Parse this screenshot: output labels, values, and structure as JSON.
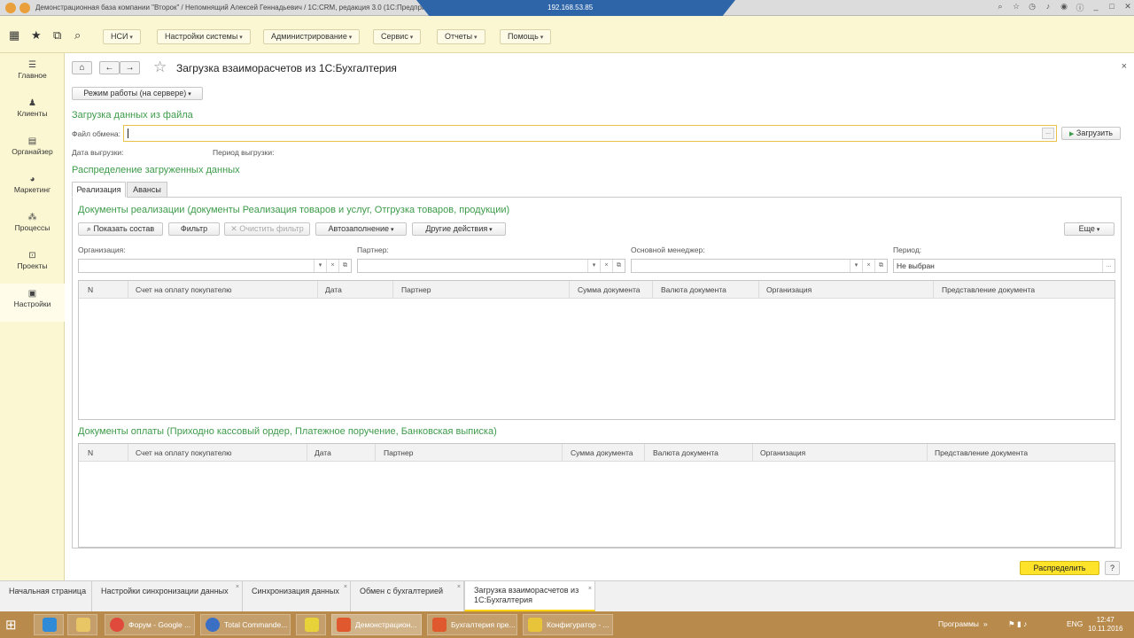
{
  "window": {
    "title": "Демонстрационная база компании \"Второк\" / Непомнящий Алексей Геннадьевич / 1С:CRM, редакция 3.0 (1С:Предприя...",
    "remote_ip": "192.168.53.85"
  },
  "menu": {
    "items": [
      "НСИ",
      "Настройки системы",
      "Администрирование",
      "Сервис",
      "Отчеты",
      "Помощь"
    ]
  },
  "sidebar": {
    "items": [
      {
        "label": "Главное",
        "icon": "menu-icon"
      },
      {
        "label": "Клиенты",
        "icon": "clients-icon"
      },
      {
        "label": "Органайзер",
        "icon": "calendar-icon"
      },
      {
        "label": "Маркетинг",
        "icon": "pie-chart-icon"
      },
      {
        "label": "Процессы",
        "icon": "process-icon"
      },
      {
        "label": "Проекты",
        "icon": "projects-icon"
      },
      {
        "label": "Настройки",
        "icon": "settings-icon"
      }
    ],
    "active_index": 6
  },
  "page": {
    "title": "Загрузка взаиморасчетов из 1С:Бухгалтерия",
    "mode_button": "Режим работы (на сервере)",
    "section_load": "Загрузка данных из файла",
    "file_label": "Файл обмена:",
    "file_value": "",
    "load_button": "Загрузить",
    "export_date_label": "Дата выгрузки:",
    "export_period_label": "Период выгрузки:",
    "section_distribution": "Распределение загруженных данных",
    "tabs": [
      "Реализация",
      "Авансы"
    ],
    "active_tab": 0,
    "sales_title": "Документы реализации (документы Реализация товаров и услуг, Отгрузка товаров, продукции)",
    "toolbar": {
      "show": "Показать состав",
      "filter": "Фильтр",
      "clear_filter": "Очистить фильтр",
      "autofill": "Автозаполнение",
      "other": "Другие действия",
      "more": "Еще"
    },
    "filters": {
      "org_label": "Организация:",
      "partner_label": "Партнер:",
      "manager_label": "Основной менеджер:",
      "period_label": "Период:",
      "period_value": "Не выбран"
    },
    "sales_columns": [
      "N",
      "Счет на оплату покупателю",
      "Дата",
      "Партнер",
      "Сумма документа",
      "Валюта документа",
      "Организация",
      "Представление документа"
    ],
    "payments_title": "Документы оплаты (Приходно кассовый ордер, Платежное поручение, Банковская выписка)",
    "payments_columns": [
      "N",
      "Счет на оплату покупателю",
      "Дата",
      "Партнер",
      "Сумма документа",
      "Валюта документа",
      "Организация",
      "Представление документа"
    ],
    "distribute_button": "Распределить",
    "help_button": "?"
  },
  "open_windows": [
    {
      "label": "Начальная страница",
      "closable": false
    },
    {
      "label": "Настройки синхронизации данных",
      "closable": true
    },
    {
      "label": "Синхронизация данных",
      "closable": true
    },
    {
      "label": "Обмен с бухгалтерией",
      "closable": true
    },
    {
      "label": "Загрузка взаиморасчетов из 1С:Бухгалтерия",
      "closable": true
    }
  ],
  "taskbar": {
    "items": [
      {
        "label": "Форум - Google ...",
        "color": "#e04a3c"
      },
      {
        "label": "Total Commande...",
        "color": "#3a6fc4"
      },
      {
        "label": "",
        "color": "#e8d23a"
      },
      {
        "label": "Демонстрацион...",
        "color": "#e0582e"
      },
      {
        "label": "Бухгалтерия пре...",
        "color": "#e0582e"
      },
      {
        "label": "Конфигуратор - ...",
        "color": "#e8c43a"
      }
    ],
    "tray_programs": "Программы",
    "lang": "ENG",
    "time": "12:47",
    "date": "10.11.2016"
  },
  "colors": {
    "accent_green": "#3d9b4a",
    "menu_bg": "#fbf7d3",
    "primary_yellow": "#ffe32a",
    "taskbar": "#b88a4c"
  }
}
